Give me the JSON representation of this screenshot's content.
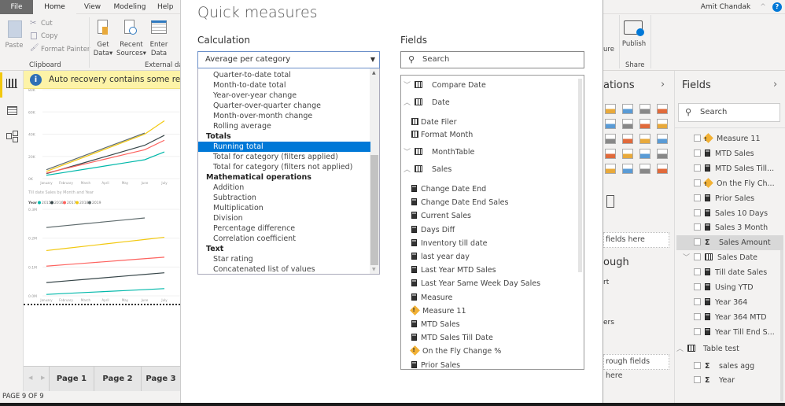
{
  "menu": {
    "tabs": [
      "File",
      "Home",
      "View",
      "Modeling",
      "Help"
    ],
    "user": "Amit Chandak"
  },
  "ribbon": {
    "paste": "Paste",
    "cut": "Cut",
    "copy": "Copy",
    "format_painter": "Format Painter",
    "get_data": [
      "Get",
      "Data"
    ],
    "recent_sources": [
      "Recent",
      "Sources"
    ],
    "enter_data": [
      "Enter",
      "Data"
    ],
    "clipboard_group": "Clipboard",
    "external_group": "External data",
    "measure_partial": "ure",
    "publish": "Publish",
    "share_group": "Share"
  },
  "banner": {
    "text": "Auto recovery contains some recovered"
  },
  "report": {
    "chart_data": [
      {
        "type": "line",
        "categories": [
          "January",
          "February",
          "March",
          "April",
          "May",
          "June",
          "July"
        ],
        "yticks": [
          "0K",
          "20K",
          "40K",
          "60K",
          "80K"
        ],
        "ylim": [
          0,
          80000
        ],
        "series": [
          {
            "name": "2015",
            "color": "#01b8aa",
            "values": [
              3000,
              5800,
              8600,
              11400,
              14200,
              17000,
              24000
            ]
          },
          {
            "name": "2016",
            "color": "#374649",
            "values": [
              4500,
              9600,
              14700,
              19800,
              24900,
              30000,
              39000
            ]
          },
          {
            "name": "2017",
            "color": "#fd625e",
            "values": [
              5000,
              9200,
              13400,
              17600,
              21800,
              26000,
              34500
            ]
          },
          {
            "name": "2018",
            "color": "#f2c80f",
            "values": [
              6500,
              13200,
              19900,
              26600,
              33300,
              40000,
              52000
            ]
          },
          {
            "name": "2019",
            "color": "#5f6b6d",
            "values": [
              8000,
              14600,
              21200,
              27800,
              34400,
              41000,
              null
            ]
          }
        ]
      },
      {
        "type": "line",
        "title": "Till date Sales by Month and Year",
        "legend_title": "Year",
        "categories": [
          "January",
          "February",
          "March",
          "April",
          "May",
          "June",
          "July"
        ],
        "yticks": [
          "0.0M",
          "0.1M",
          "0.2M",
          "0.3M"
        ],
        "ylim": [
          0,
          300000
        ],
        "series": [
          {
            "name": "2015",
            "color": "#01b8aa",
            "values": [
              5000,
              8300,
              11700,
              15000,
              18300,
              21700,
              25000
            ]
          },
          {
            "name": "2016",
            "color": "#374649",
            "values": [
              46000,
              51700,
              57300,
              63000,
              68700,
              74300,
              80000
            ]
          },
          {
            "name": "2017",
            "color": "#fd625e",
            "values": [
              103000,
              108200,
              113300,
              118500,
              123700,
              128800,
              134000
            ]
          },
          {
            "name": "2018",
            "color": "#f2c80f",
            "values": [
              157000,
              164700,
              172300,
              180000,
              187700,
              195300,
              203000
            ]
          },
          {
            "name": "2019",
            "color": "#5f6b6d",
            "values": [
              237000,
              243600,
              250200,
              256800,
              263400,
              270000,
              null
            ]
          }
        ]
      }
    ]
  },
  "pages": {
    "tabs": [
      "Page 1",
      "Page 2",
      "Page 3"
    ],
    "status": "PAGE 9 OF 9"
  },
  "dialog": {
    "title": "Quick measures",
    "calc_label": "Calculation",
    "calc_value": "Average per category",
    "calc_options": [
      {
        "t": "Quarter-to-date total"
      },
      {
        "t": "Month-to-date total"
      },
      {
        "t": "Year-over-year change"
      },
      {
        "t": "Quarter-over-quarter change"
      },
      {
        "t": "Month-over-month change"
      },
      {
        "t": "Rolling average"
      },
      {
        "t": "Totals",
        "h": true
      },
      {
        "t": "Running total",
        "sel": true
      },
      {
        "t": "Total for category (filters applied)"
      },
      {
        "t": "Total for category (filters not applied)"
      },
      {
        "t": "Mathematical operations",
        "h": true
      },
      {
        "t": "Addition"
      },
      {
        "t": "Subtraction"
      },
      {
        "t": "Multiplication"
      },
      {
        "t": "Division"
      },
      {
        "t": "Percentage difference"
      },
      {
        "t": "Correlation coefficient"
      },
      {
        "t": "Text",
        "h": true
      },
      {
        "t": "Star rating"
      },
      {
        "t": "Concatenated list of values"
      }
    ],
    "fields_label": "Fields",
    "search_placeholder": "Search",
    "fields": [
      {
        "t": "Compare Date",
        "k": "table",
        "exp": false
      },
      {
        "t": "Date",
        "k": "table",
        "exp": true
      },
      {
        "t": "Date Filer",
        "k": "column"
      },
      {
        "t": "Format Month",
        "k": "column"
      },
      {
        "t": "MonthTable",
        "k": "table",
        "exp": false
      },
      {
        "t": "Sales",
        "k": "table",
        "exp": true
      },
      {
        "t": "Change Date End",
        "k": "measure"
      },
      {
        "t": "Change Date End Sales",
        "k": "measure"
      },
      {
        "t": "Current Sales",
        "k": "measure"
      },
      {
        "t": "Days Diff",
        "k": "measure"
      },
      {
        "t": "Inventory till date",
        "k": "measure"
      },
      {
        "t": "last year day",
        "k": "measure"
      },
      {
        "t": "Last Year MTD Sales",
        "k": "measure"
      },
      {
        "t": "Last Year Same Week Day Sales",
        "k": "measure"
      },
      {
        "t": "Measure",
        "k": "measure"
      },
      {
        "t": "Measure 11",
        "k": "warning"
      },
      {
        "t": "MTD Sales",
        "k": "measure"
      },
      {
        "t": "MTD Sales Till Date",
        "k": "measure"
      },
      {
        "t": "On the Fly Change %",
        "k": "warning"
      },
      {
        "t": "Prior Sales",
        "k": "measure"
      }
    ]
  },
  "viz_pane": {
    "title_partial": "ations",
    "drop1": "fields here",
    "section_partial": "ough",
    "item1": "rt",
    "item2": "ers",
    "drop2": "rough fields here"
  },
  "fields_pane": {
    "title": "Fields",
    "search_placeholder": "Search",
    "items": [
      {
        "t": "Measure 11",
        "k": "warning"
      },
      {
        "t": "MTD Sales",
        "k": "measure"
      },
      {
        "t": "MTD Sales Till...",
        "k": "measure"
      },
      {
        "t": "On the Fly Ch...",
        "k": "warning"
      },
      {
        "t": "Prior Sales",
        "k": "measure"
      },
      {
        "t": "Sales 10 Days",
        "k": "measure"
      },
      {
        "t": "Sales 3 Month",
        "k": "measure"
      },
      {
        "t": "Sales Amount",
        "k": "sum",
        "hl": true
      },
      {
        "t": "Sales Date",
        "k": "date",
        "chev": true
      },
      {
        "t": "Till date Sales",
        "k": "measure"
      },
      {
        "t": "Using YTD",
        "k": "measure"
      },
      {
        "t": "Year 364",
        "k": "measure"
      },
      {
        "t": "Year 364 MTD",
        "k": "measure"
      },
      {
        "t": "Year Till End S...",
        "k": "measure"
      },
      {
        "t": "Table test",
        "k": "table"
      },
      {
        "t": "sales agg",
        "k": "sum"
      },
      {
        "t": "Year",
        "k": "sum"
      }
    ]
  }
}
